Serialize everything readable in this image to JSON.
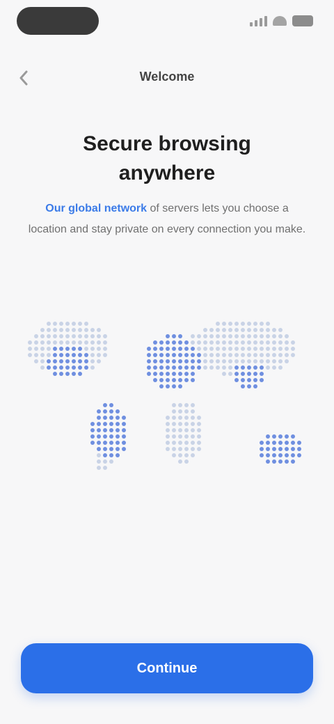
{
  "nav": {
    "title": "Welcome"
  },
  "content": {
    "headline": "Secure browsing anywhere",
    "link_text": "Our global network",
    "description_rest": " of servers lets you choose a location and stay private on every connection you make."
  },
  "cta": {
    "label": "Continue"
  },
  "colors": {
    "accent": "#2b6fe8",
    "link": "#3b7be8",
    "map_dot": "#c9d3e6",
    "map_highlight": "#6f8fe0"
  }
}
